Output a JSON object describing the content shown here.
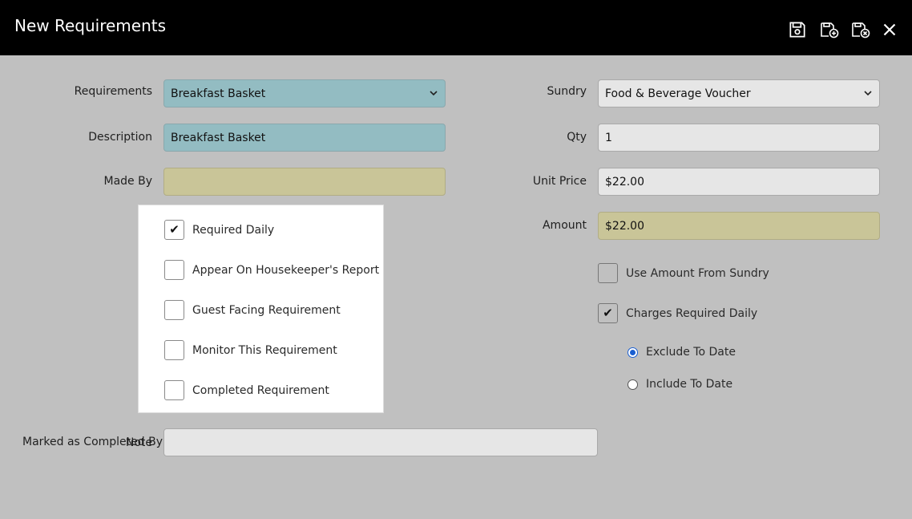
{
  "header": {
    "title": "New Requirements",
    "icons": [
      "save-icon",
      "save-and-new-icon",
      "save-and-close-icon",
      "close-icon"
    ]
  },
  "form": {
    "requirements": {
      "label": "Requirements",
      "value": "Breakfast Basket"
    },
    "description": {
      "label": "Description",
      "value": "Breakfast Basket"
    },
    "made_by": {
      "label": "Made By",
      "value": ""
    },
    "sundry": {
      "label": "Sundry",
      "value": "Food & Beverage Voucher"
    },
    "qty": {
      "label": "Qty",
      "value": "1"
    },
    "unit_price": {
      "label": "Unit Price",
      "value": "$22.00"
    },
    "amount": {
      "label": "Amount",
      "value": "$22.00"
    },
    "marked_completed_by": {
      "label": "Marked as Completed By"
    },
    "note": {
      "label": "Note",
      "value": ""
    }
  },
  "checkboxes": [
    {
      "label": "Required Daily",
      "checked": true
    },
    {
      "label": "Appear On Housekeeper's Report",
      "checked": false
    },
    {
      "label": "Guest Facing Requirement",
      "checked": false
    },
    {
      "label": "Monitor This Requirement",
      "checked": false
    },
    {
      "label": "Completed Requirement",
      "checked": false
    }
  ],
  "right_options": {
    "use_amount_from_sundry": {
      "label": "Use Amount From Sundry",
      "checked": false
    },
    "charges_required_daily": {
      "label": "Charges Required Daily",
      "checked": true
    },
    "exclude_to_date": {
      "label": "Exclude To Date",
      "selected": true
    },
    "include_to_date": {
      "label": "Include To Date",
      "selected": false
    }
  },
  "colors": {
    "teal": "#93bcc2",
    "khaki": "#c9c598",
    "radio_accent": "#1a5fd1"
  }
}
